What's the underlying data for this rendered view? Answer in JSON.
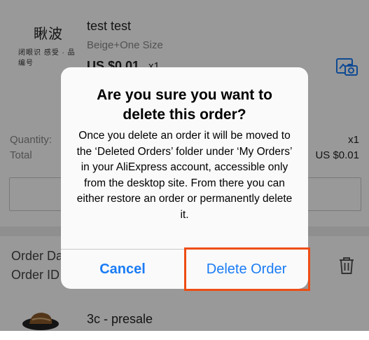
{
  "product1": {
    "thumb_line1": "瞅波",
    "thumb_line2": "闭眼识 感受 · 品 编号",
    "title": "test test",
    "variant": "Beige+One Size",
    "price": "US $0.01",
    "qty_small": "x1"
  },
  "summary": {
    "quantity_label": "Quantity:",
    "total_label": "Total",
    "quantity_value": "x1",
    "total_value": "US $0.01"
  },
  "order2": {
    "date_label": "Order Da",
    "id_label": "Order ID",
    "product_title": "3c - presale"
  },
  "dialog": {
    "title": "Are you sure you want to delete this order?",
    "message": "Once you delete an order it will be moved to the ‘Deleted Orders’ folder under ‘My Orders’ in your AliExpress account, accessible only from the desktop site. From there you can either restore an order or permanently delete it.",
    "cancel_label": "Cancel",
    "delete_label": "Delete Order"
  },
  "colors": {
    "accent_blue": "#1a7cf5",
    "highlight": "#ee4d14"
  },
  "icons": [
    "camera-photo-icon",
    "trash-icon"
  ]
}
